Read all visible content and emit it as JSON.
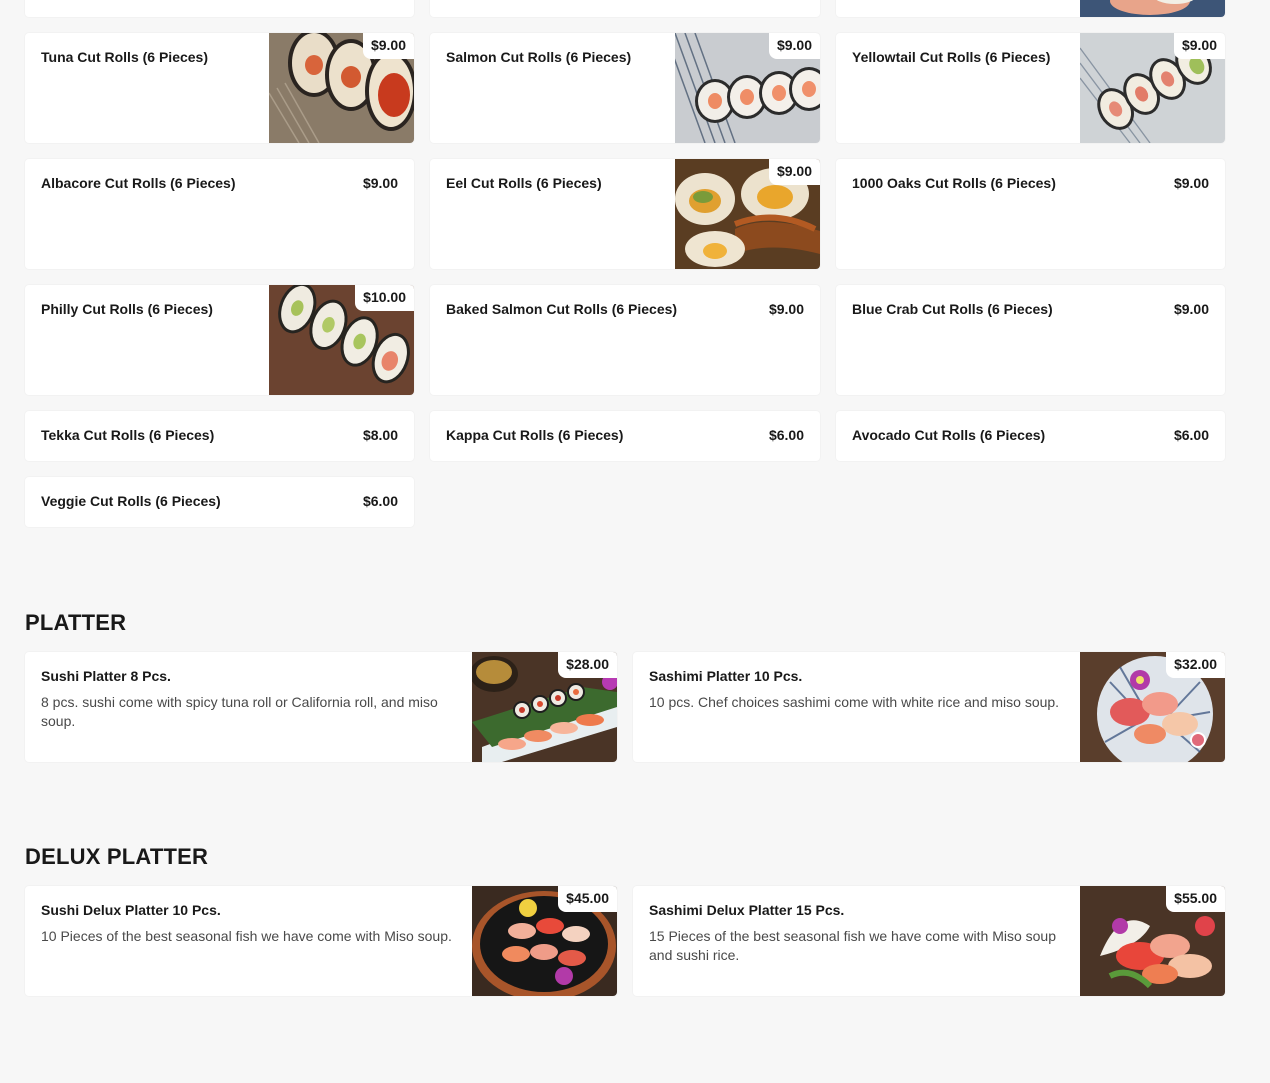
{
  "cut_rolls": {
    "top_row": [
      "",
      "",
      ""
    ],
    "items": [
      {
        "name": "Tuna Cut Rolls (6 Pieces)",
        "price": "$9.00",
        "image": "tuna-roll"
      },
      {
        "name": "Salmon Cut Rolls (6 Pieces)",
        "price": "$9.00",
        "image": "salmon-roll"
      },
      {
        "name": "Yellowtail Cut Rolls (6 Pieces)",
        "price": "$9.00",
        "image": "yellowtail-roll"
      },
      {
        "name": "Albacore Cut Rolls (6 Pieces)",
        "price": "$9.00",
        "image": null
      },
      {
        "name": "Eel Cut Rolls (6 Pieces)",
        "price": "$9.00",
        "image": "eel-roll"
      },
      {
        "name": "1000 Oaks Cut Rolls (6 Pieces)",
        "price": "$9.00",
        "image": null
      },
      {
        "name": "Philly Cut Rolls (6 Pieces)",
        "price": "$10.00",
        "image": "philly-roll"
      },
      {
        "name": "Baked Salmon Cut Rolls (6 Pieces)",
        "price": "$9.00",
        "image": null
      },
      {
        "name": "Blue Crab Cut Rolls (6 Pieces)",
        "price": "$9.00",
        "image": null
      },
      {
        "name": "Tekka Cut Rolls (6 Pieces)",
        "price": "$8.00",
        "image": null
      },
      {
        "name": "Kappa Cut Rolls (6 Pieces)",
        "price": "$6.00",
        "image": null
      },
      {
        "name": "Avocado Cut Rolls (6 Pieces)",
        "price": "$6.00",
        "image": null
      },
      {
        "name": "Veggie Cut Rolls (6 Pieces)",
        "price": "$6.00",
        "image": null
      }
    ]
  },
  "platter": {
    "title": "PLATTER",
    "items": [
      {
        "name": "Sushi Platter 8 Pcs.",
        "description": "8 pcs. sushi come with spicy tuna roll or California roll, and miso soup.",
        "price": "$28.00",
        "image": "sushi-platter"
      },
      {
        "name": "Sashimi Platter 10 Pcs.",
        "description": "10 pcs. Chef choices sashimi come with white rice and miso soup.",
        "price": "$32.00",
        "image": "sashimi-platter"
      }
    ]
  },
  "delux_platter": {
    "title": "DELUX PLATTER",
    "items": [
      {
        "name": "Sushi Delux Platter 10 Pcs.",
        "description": "10 Pieces of the best seasonal fish we have come with Miso soup.",
        "price": "$45.00",
        "image": "sushi-delux-platter"
      },
      {
        "name": "Sashimi Delux Platter 15 Pcs.",
        "description": "15 Pieces of the best seasonal fish we have come with Miso soup and sushi rice.",
        "price": "$55.00",
        "image": "sashimi-delux-platter"
      }
    ]
  }
}
